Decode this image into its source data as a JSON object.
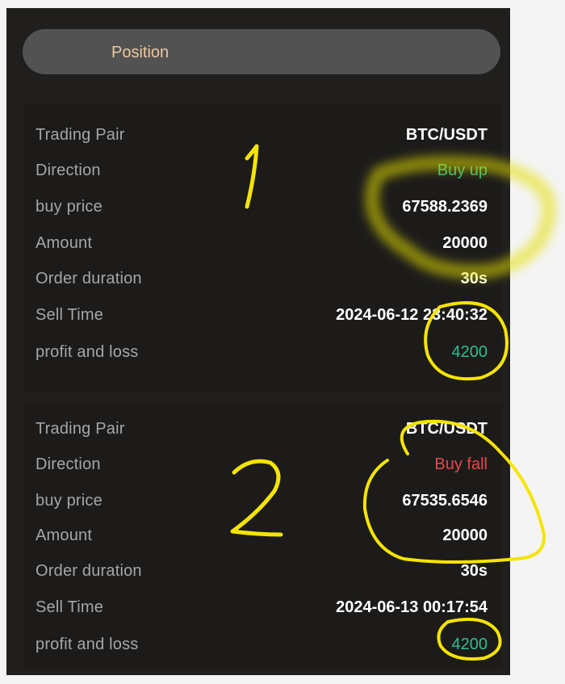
{
  "tab": {
    "label": "Position"
  },
  "orders": [
    {
      "rows": [
        {
          "label": "Trading Pair",
          "value": "BTC/USDT"
        },
        {
          "label": "Direction",
          "value": "Buy up"
        },
        {
          "label": "buy price",
          "value": "67588.2369"
        },
        {
          "label": "Amount",
          "value": "20000"
        },
        {
          "label": "Order duration",
          "value": "30s"
        },
        {
          "label": "Sell Time",
          "value": "2024-06-12 23:40:32"
        },
        {
          "label": "profit and loss",
          "value": "4200"
        }
      ]
    },
    {
      "rows": [
        {
          "label": "Trading Pair",
          "value": "BTC/USDT"
        },
        {
          "label": "Direction",
          "value": "Buy fall"
        },
        {
          "label": "buy price",
          "value": "67535.6546"
        },
        {
          "label": "Amount",
          "value": "20000"
        },
        {
          "label": "Order duration",
          "value": "30s"
        },
        {
          "label": "Sell Time",
          "value": "2024-06-13 00:17:54"
        },
        {
          "label": "profit and loss",
          "value": "4200"
        }
      ]
    }
  ],
  "annotations": {
    "color": "#f5e400"
  },
  "colors": {
    "up": "#2fbe72",
    "fall": "#e8474b",
    "profit": "#2fbe8e",
    "tab_text": "#e9c9a0"
  }
}
